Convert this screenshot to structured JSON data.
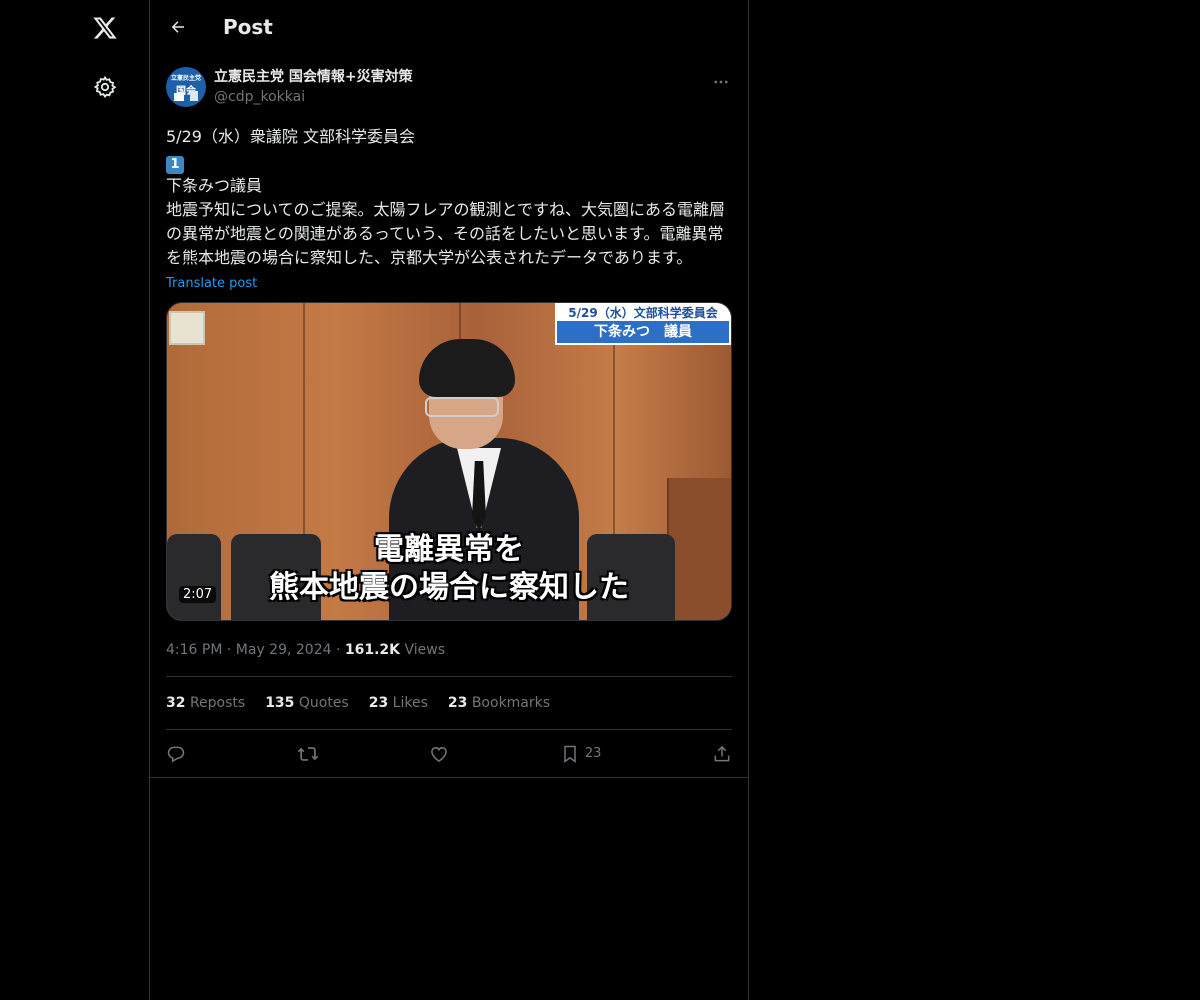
{
  "header": {
    "title": "Post"
  },
  "author": {
    "display_name": "立憲民主党 国会情報+災害対策",
    "handle": "@cdp_kokkai",
    "avatar_top": "立憲民主党",
    "avatar_mid": "国会"
  },
  "post": {
    "line1": "5/29（水）衆議院 文部科学委員会",
    "keycap": "1",
    "line2": "下条みつ議員",
    "line3": "地震予知についてのご提案。太陽フレアの観測とですね、大気圏にある電離層の異常が地震との関連があるっていう、その話をしたいと思います。電離異常を熊本地震の場合に察知した、京都大学が公表されたデータであります。",
    "translate": "Translate post"
  },
  "video": {
    "banner_top": "5/29（水）文部科学委員会",
    "banner_bottom": "下条みつ　議員",
    "caption_line1": "電離異常を",
    "caption_line2": "熊本地震の場合に察知した",
    "duration": "2:07"
  },
  "meta": {
    "time": "4:16 PM",
    "sep1": "·",
    "date": "May 29, 2024",
    "sep2": "·",
    "views_count": "161.2K",
    "views_label": "Views"
  },
  "stats": {
    "reposts": {
      "count": "32",
      "label": "Reposts"
    },
    "quotes": {
      "count": "135",
      "label": "Quotes"
    },
    "likes": {
      "count": "23",
      "label": "Likes"
    },
    "bookmarks": {
      "count": "23",
      "label": "Bookmarks"
    }
  },
  "actions": {
    "bookmark_count": "23"
  }
}
